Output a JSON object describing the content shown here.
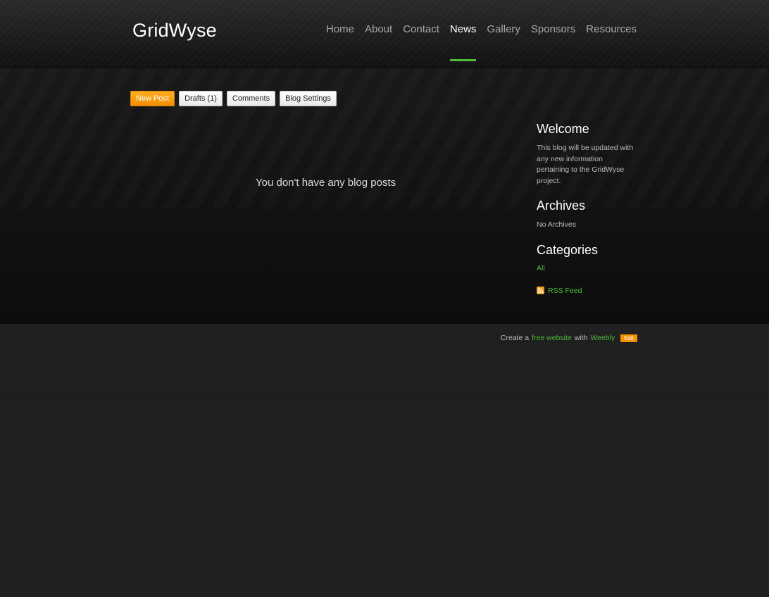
{
  "header": {
    "site_title": "GridWyse",
    "nav": [
      "Home",
      "About",
      "Contact",
      "News",
      "Gallery",
      "Sponsors",
      "Resources"
    ],
    "active_index": 3
  },
  "toolbar": {
    "new_post": "New Post",
    "drafts": "Drafts (1)",
    "comments": "Comments",
    "blog_settings": "Blog Settings"
  },
  "main": {
    "empty_message": "You don't have any blog posts"
  },
  "sidebar": {
    "welcome_title": "Welcome",
    "welcome_text": "This blog will be updated with any new information pertaining to the GridWyse project.",
    "archives_title": "Archives",
    "archives_text": "No Archives",
    "categories_title": "Categories",
    "category_all": "All",
    "rss_label": "RSS Feed"
  },
  "footer": {
    "create_a": "Create a",
    "free_website": "free website",
    "with": "with",
    "weebly": "Weebly",
    "edit": "Edit"
  },
  "colors": {
    "accent_green": "#4fbb3a",
    "accent_orange": "#f38f00"
  }
}
